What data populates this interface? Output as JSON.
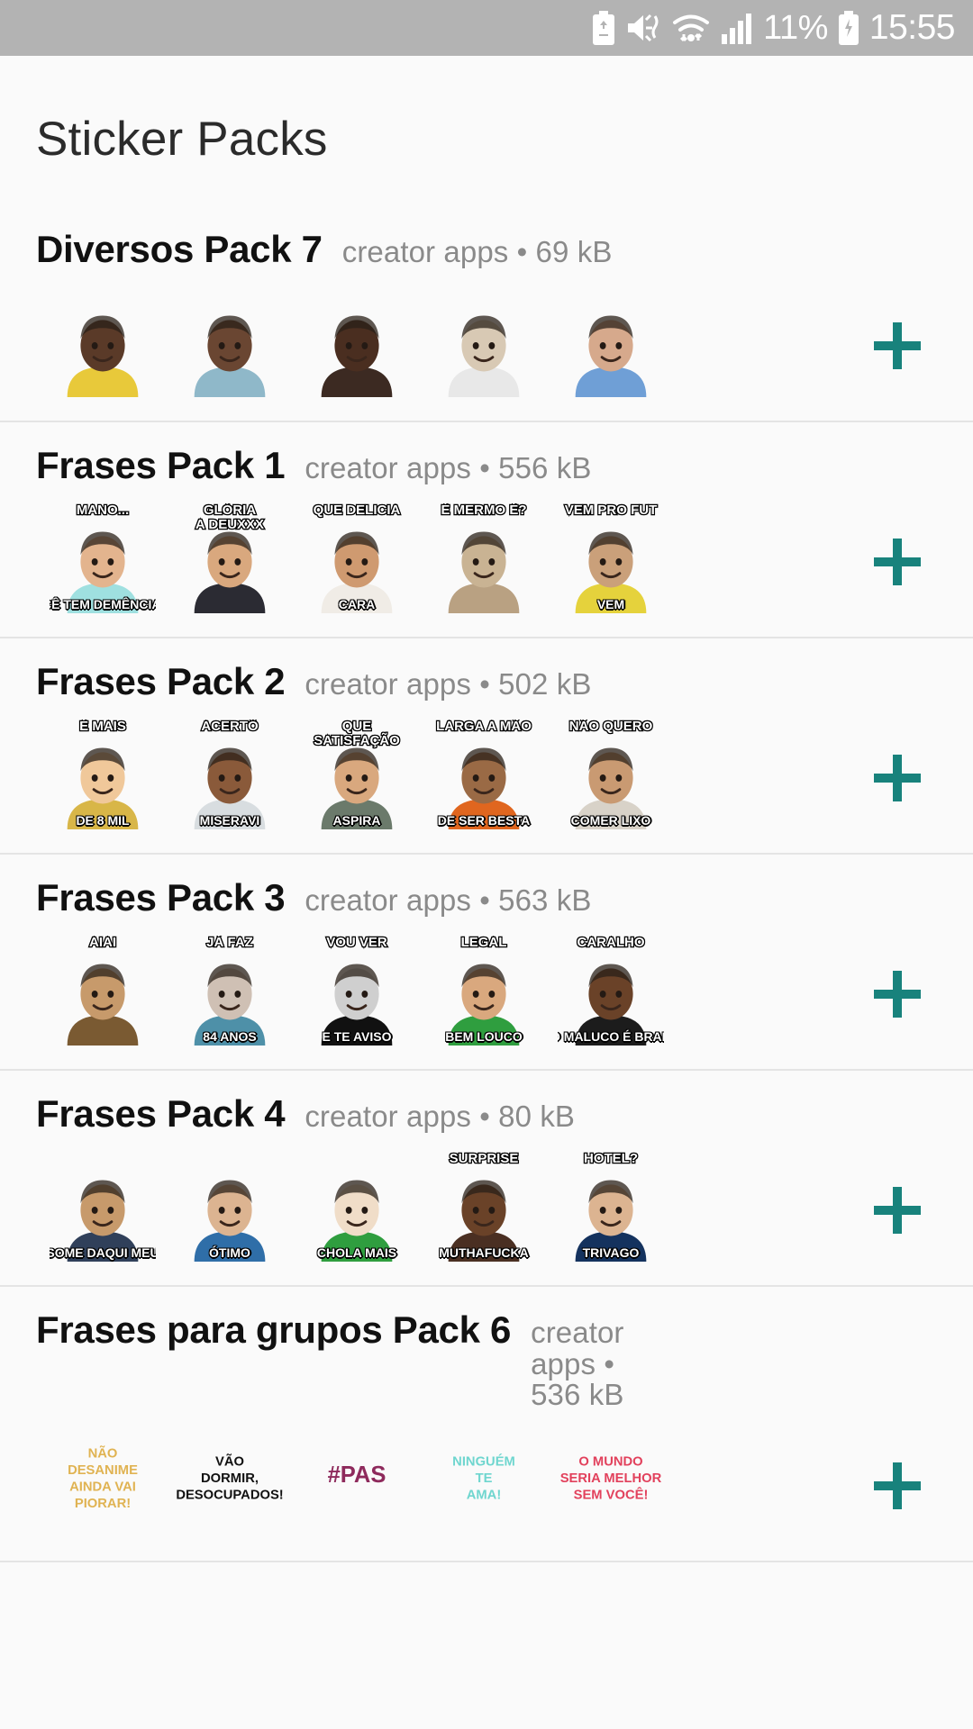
{
  "status_bar": {
    "icons": [
      "battery-saver-icon",
      "mute-vibrate-icon",
      "wifi-icon",
      "signal-icon"
    ],
    "battery_percent": "11%",
    "charging_icon": "charging-battery-icon",
    "time": "15:55"
  },
  "header": {
    "title": "Sticker Packs"
  },
  "theme": {
    "accent": "#18827c",
    "background": "#fafafa",
    "divider": "#e4e4e4",
    "title_color": "#2b2b2b",
    "meta_color": "#8a8a8a"
  },
  "add_button_label": "+",
  "packs": [
    {
      "name": "Diversos Pack 7",
      "publisher": "creator apps",
      "separator": "•",
      "size": "69 kB",
      "meta": "creator apps • 69 kB",
      "wrap": false,
      "stickers": [
        {
          "name": "man-yellow-shirt-sticker",
          "top": "",
          "bottom": "",
          "skin": "#5a3a28",
          "shirt": "#e8c93a"
        },
        {
          "name": "man-hoodie-glasses-sticker",
          "top": "",
          "bottom": "",
          "skin": "#6a4632",
          "shirt": "#8fb8c9"
        },
        {
          "name": "man-shouting-sticker",
          "top": "",
          "bottom": "",
          "skin": "#4a2e20",
          "shirt": "#3c2a22"
        },
        {
          "name": "old-man-angry-sticker",
          "top": "",
          "bottom": "",
          "skin": "#d8c9b4",
          "shirt": "#e8e8e8"
        },
        {
          "name": "man-blue-shirt-yelling-sticker",
          "top": "",
          "bottom": "",
          "skin": "#d6a98c",
          "shirt": "#6f9fd6"
        }
      ]
    },
    {
      "name": "Frases Pack 1",
      "publisher": "creator apps",
      "separator": "•",
      "size": "556 kB",
      "meta": "creator apps • 556 kB",
      "wrap": false,
      "stickers": [
        {
          "name": "boy-pointing-sticker",
          "top": "MANO...",
          "bottom": "CÊ TEM DEMÊNCIA?",
          "skin": "#e3b48e",
          "shirt": "#9fe0e0"
        },
        {
          "name": "politician-praying-sticker",
          "top": "GLÓRIA\nA DEUXXX",
          "bottom": "",
          "skin": "#d9a87e",
          "shirt": "#2b2b33"
        },
        {
          "name": "man-drinking-sticker",
          "top": "QUE DELICIA",
          "bottom": "CARA",
          "skin": "#cf9a70",
          "shirt": "#f0ece6"
        },
        {
          "name": "meerkat-sticker",
          "top": "É MERMO É?",
          "bottom": "",
          "skin": "#c9b393",
          "shirt": "#b9a182"
        },
        {
          "name": "man-yellow-shirt-vem-sticker",
          "top": "VEM PRO FUT",
          "bottom": "VEM",
          "skin": "#caa07a",
          "shirt": "#e5d23c"
        }
      ]
    },
    {
      "name": "Frases Pack 2",
      "publisher": "creator apps",
      "separator": "•",
      "size": "502 kB",
      "meta": "creator apps • 502 kB",
      "wrap": false,
      "stickers": [
        {
          "name": "vegeta-sticker",
          "top": "É MAIS",
          "bottom": "DE 8 MIL",
          "skin": "#f0c89a",
          "shirt": "#d8b648"
        },
        {
          "name": "man-laughing-sticker",
          "top": "ACERTÔ",
          "bottom": "MISERAVI",
          "skin": "#8a5a3a",
          "shirt": "#d8dde0"
        },
        {
          "name": "officer-laughing-sticker",
          "top": "QUE SATISFAÇÃO",
          "bottom": "ASPIRA",
          "skin": "#d9a87e",
          "shirt": "#6b7a6b"
        },
        {
          "name": "man-orange-shirt-sticker",
          "top": "LARGA A MÃO",
          "bottom": "DE SER BESTA",
          "skin": "#9a6a45",
          "shirt": "#e0661f"
        },
        {
          "name": "boy-cap-sticker",
          "top": "NÃO QUERO",
          "bottom": "COMER LIXO",
          "skin": "#c99a72",
          "shirt": "#d8d2c8"
        }
      ]
    },
    {
      "name": "Frases Pack 3",
      "publisher": "creator apps",
      "separator": "•",
      "size": "563 kB",
      "meta": "creator apps • 563 kB",
      "wrap": false,
      "stickers": [
        {
          "name": "man-bar-scene-sticker",
          "top": "AIAI",
          "bottom": "",
          "skin": "#c79a6b",
          "shirt": "#7a5a32"
        },
        {
          "name": "old-woman-sticker",
          "top": "JÁ FAZ",
          "bottom": "84 ANOS",
          "skin": "#cfc0b4",
          "shirt": "#4e90a8"
        },
        {
          "name": "grim-reaper-sticker",
          "top": "VOU VER",
          "bottom": "E TE AVISO",
          "skin": "#cfcfcf",
          "shirt": "#111111"
        },
        {
          "name": "girl-green-shirt-interview-sticker",
          "top": "LEGAL",
          "bottom": "BEM LOUCO",
          "skin": "#d9a87e",
          "shirt": "#2f9e3f"
        },
        {
          "name": "man-cap-laughing-sticker",
          "top": "CARALHO",
          "bottom": "O MALUCO É BRABO",
          "skin": "#6a4228",
          "shirt": "#1c1c1c"
        }
      ]
    },
    {
      "name": "Frases Pack 4",
      "publisher": "creator apps",
      "separator": "•",
      "size": "80 kB",
      "meta": "creator apps • 80 kB",
      "wrap": false,
      "stickers": [
        {
          "name": "table-argument-sticker",
          "top": "",
          "bottom": "SOME DAQUI MEU",
          "skin": "#c79a6b",
          "shirt": "#30405a"
        },
        {
          "name": "woman-serious-sticker",
          "top": "",
          "bottom": "ÓTIMO",
          "skin": "#dcb491",
          "shirt": "#2f6ea8"
        },
        {
          "name": "cebolinha-sticker",
          "top": "",
          "bottom": "CHOLA MAIS",
          "skin": "#f0ddc8",
          "shirt": "#2f9e3f"
        },
        {
          "name": "man-surprise-sticker",
          "top": "SURPRISE",
          "bottom": "MUTHAFUCKA",
          "skin": "#6a4228",
          "shirt": "#4a2f22"
        },
        {
          "name": "trivago-guy-sticker",
          "top": "HOTEL?",
          "bottom": "TRIVAGO",
          "skin": "#dcb491",
          "shirt": "#14325e"
        }
      ]
    },
    {
      "name": "Frases para grupos Pack 6",
      "publisher": "creator apps",
      "separator": "•",
      "size": "536 kB",
      "meta": "creator apps • 536 kB",
      "wrap": true,
      "stickers": [
        {
          "name": "nao-desanime-text-sticker",
          "top": "",
          "bottom": "",
          "skin": "#e0b352",
          "shirt": "#e0b352",
          "text_art": [
            "NÃO",
            "DESANIME",
            "AINDA VAI",
            "PIORAR!"
          ],
          "art_color": "#e0b352"
        },
        {
          "name": "vao-dormir-text-sticker",
          "top": "",
          "bottom": "",
          "skin": "#111111",
          "shirt": "#111111",
          "text_art": [
            "VÃO",
            "DORMIR,",
            "DESOCUPADOS!"
          ],
          "art_color": "#111111"
        },
        {
          "name": "hashtag-pas-text-sticker",
          "top": "",
          "bottom": "",
          "skin": "#8e2a5c",
          "shirt": "#8e2a5c",
          "text_art": [
            "#PAS"
          ],
          "art_color": "#8e2a5c"
        },
        {
          "name": "ninguem-te-ama-text-sticker",
          "top": "",
          "bottom": "",
          "skin": "#6fd6cf",
          "shirt": "#8e2a5c",
          "text_art": [
            "NINGUÉM",
            "TE",
            "AMA!"
          ],
          "art_color": "#6fd6cf"
        },
        {
          "name": "o-mundo-seria-melhor-text-sticker",
          "top": "",
          "bottom": "",
          "skin": "#e2415c",
          "shirt": "#e2415c",
          "text_art": [
            "O MUNDO",
            "SERIA MELHOR",
            "SEM VOCÊ!"
          ],
          "art_color": "#e2415c"
        }
      ]
    }
  ]
}
